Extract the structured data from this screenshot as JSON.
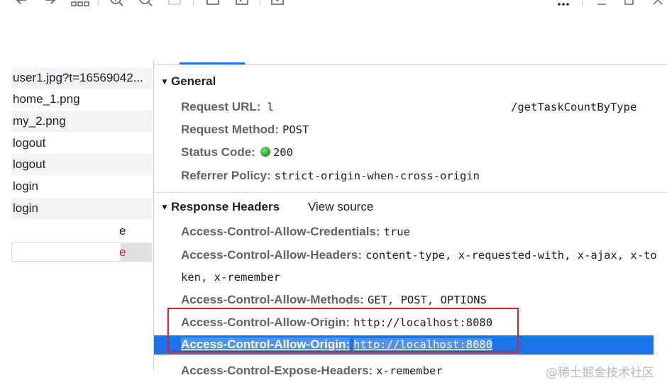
{
  "toolbar": {
    "icons": [
      "back-arrow-icon",
      "forward-arrow-icon",
      "grid-icon",
      "zoom-in-icon",
      "zoom-out-icon",
      "fit-icon",
      "square-icon",
      "export-icon",
      "download-icon",
      "more-icon",
      "minimize-icon",
      "maximize-icon",
      "close-icon"
    ]
  },
  "requests": [
    {
      "name": "user1.jpg?t=16569042..."
    },
    {
      "name": "home_1.png"
    },
    {
      "name": "my_2.png"
    },
    {
      "name": "logout"
    },
    {
      "name": "logout"
    },
    {
      "name": "login"
    },
    {
      "name": "login"
    }
  ],
  "partial_rows": [
    {
      "text": "e",
      "color": "#202124"
    },
    {
      "text": "e",
      "color": "#e02020"
    }
  ],
  "general": {
    "title": "General",
    "request_url_label": "Request URL:",
    "request_url_prefix": "l",
    "request_url_suffix": "/getTaskCountByType",
    "request_method_label": "Request Method:",
    "request_method": "POST",
    "status_code_label": "Status Code:",
    "status_code": "200",
    "status_color": "#1e9e1e",
    "referrer_policy_label": "Referrer Policy:",
    "referrer_policy": "strict-origin-when-cross-origin"
  },
  "response_headers": {
    "title": "Response Headers",
    "view_source": "View source",
    "items": [
      {
        "key": "Access-Control-Allow-Credentials:",
        "value": "true"
      },
      {
        "key": "Access-Control-Allow-Headers:",
        "value": "content-type, x-requested-with, x-ajax, x-to",
        "value_wrap": "ken, x-remember"
      },
      {
        "key": "Access-Control-Allow-Methods:",
        "value": "GET, POST, OPTIONS"
      },
      {
        "key": "Access-Control-Allow-Origin:",
        "value": "http://localhost:8080"
      },
      {
        "key": "Access-Control-Allow-Origin:",
        "value": "http://localhost:8080"
      },
      {
        "key": "Access-Control-Expose-Headers:",
        "value": "x-remember"
      }
    ]
  },
  "colors": {
    "accent": "#1a73e8",
    "highlight_box": "#e02020"
  },
  "watermark": "@稀土掘金技术社区"
}
